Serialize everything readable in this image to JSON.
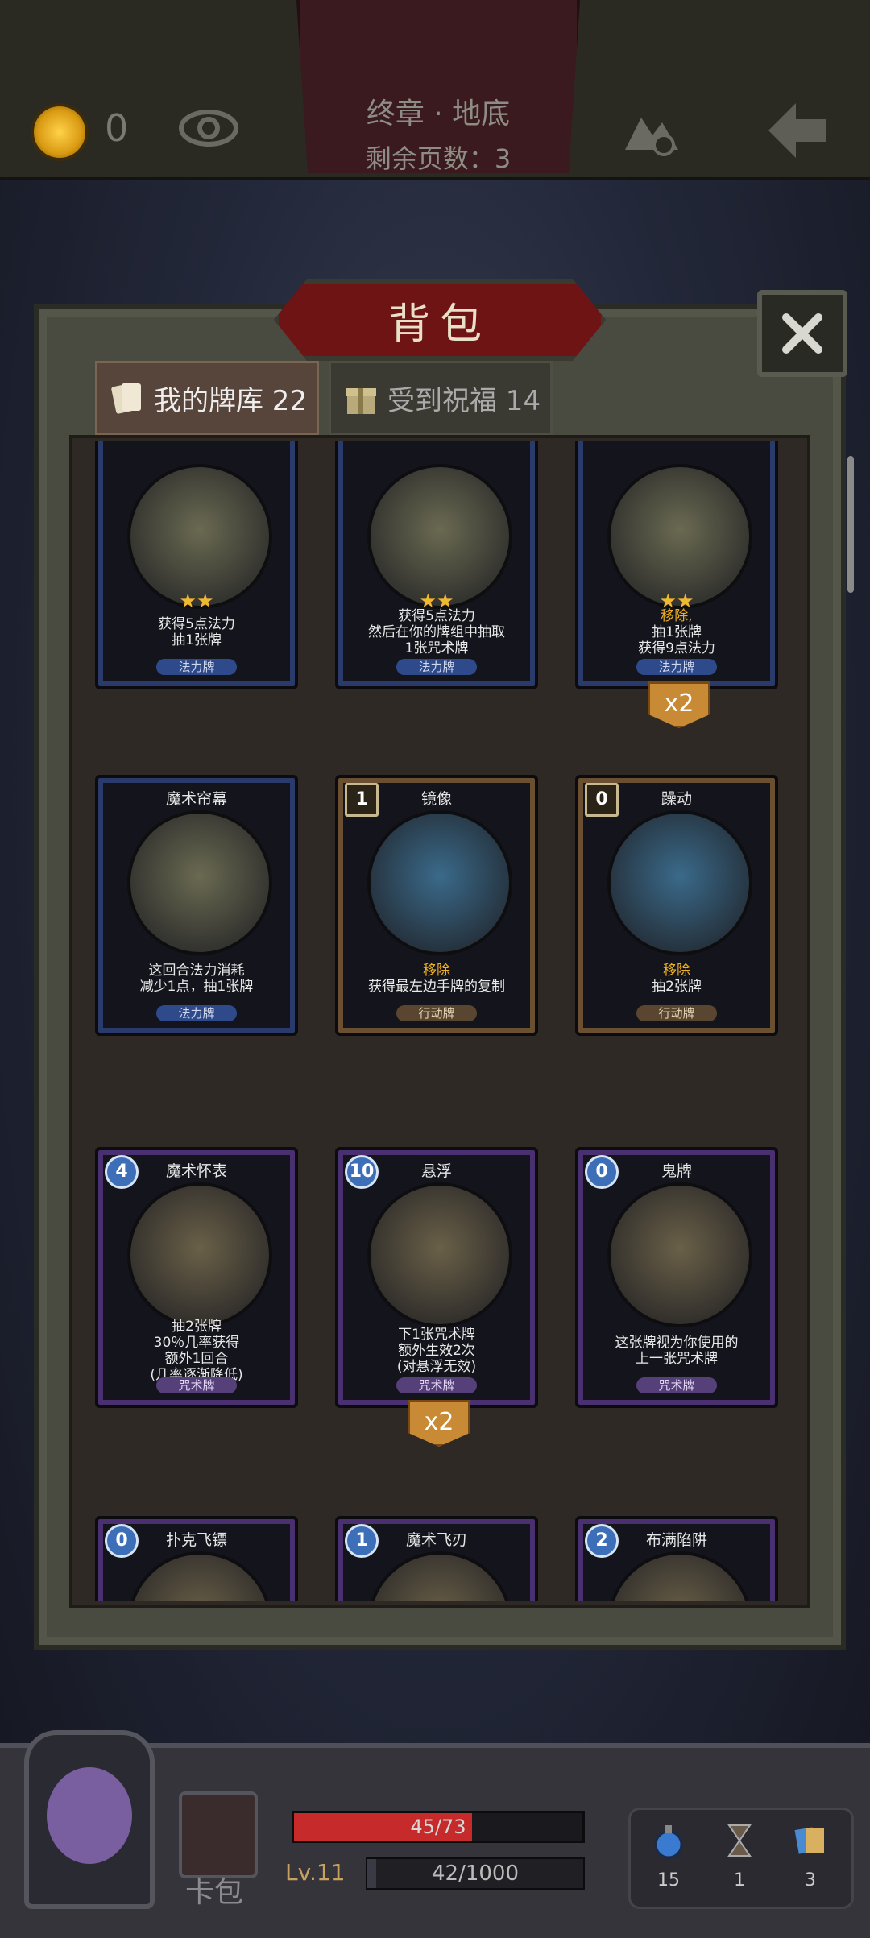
{
  "top": {
    "coins": "0",
    "chapter_title": "终章 · 地底",
    "pages_left": "剩余页数：3"
  },
  "panel": {
    "title": "背包",
    "tabs": [
      {
        "label": "我的牌库 22",
        "active": true
      },
      {
        "label": "受到祝福 14",
        "active": false
      }
    ]
  },
  "cards": [
    {
      "name": "",
      "cost": "",
      "color": "blue",
      "stars": "★★",
      "desc": [
        "获得5点法力",
        "抽1张牌"
      ],
      "highlight": "",
      "type": "法力牌",
      "qty": ""
    },
    {
      "name": "",
      "cost": "",
      "color": "blue",
      "stars": "★★",
      "desc": [
        "获得5点法力",
        "然后在你的牌组中抽取",
        "1张咒术牌"
      ],
      "highlight": "",
      "type": "法力牌",
      "qty": ""
    },
    {
      "name": "",
      "cost": "",
      "color": "blue",
      "stars": "★★",
      "desc": [
        "抽1张牌",
        "获得9点法力"
      ],
      "highlight": "移除,",
      "type": "法力牌",
      "qty": "x2"
    },
    {
      "name": "魔术帘幕",
      "cost": "",
      "color": "blue",
      "stars": "",
      "desc": [
        "这回合法力消耗",
        "减少1点，抽1张牌"
      ],
      "highlight": "",
      "type": "法力牌",
      "qty": ""
    },
    {
      "name": "镜像",
      "cost": "1",
      "color": "brown",
      "stars": "",
      "desc": [
        "获得最左边手牌的复制"
      ],
      "highlight": "移除",
      "type": "行动牌",
      "qty": ""
    },
    {
      "name": "躁动",
      "cost": "0",
      "color": "brown",
      "stars": "",
      "desc": [
        "抽2张牌"
      ],
      "highlight": "移除",
      "type": "行动牌",
      "qty": ""
    },
    {
      "name": "魔术怀表",
      "cost": "4",
      "color": "purple",
      "stars": "",
      "desc": [
        "抽2张牌",
        "30％几率获得",
        "额外1回合",
        "(几率逐渐降低)"
      ],
      "highlight": "",
      "type": "咒术牌",
      "qty": ""
    },
    {
      "name": "悬浮",
      "cost": "10",
      "color": "purple",
      "stars": "",
      "desc": [
        "下1张咒术牌",
        "额外生效2次",
        "(对悬浮无效)"
      ],
      "highlight": "",
      "type": "咒术牌",
      "qty": "x2"
    },
    {
      "name": "鬼牌",
      "cost": "0",
      "color": "purple",
      "stars": "",
      "desc": [
        "这张牌视为你使用的",
        "上一张咒术牌"
      ],
      "highlight": "",
      "type": "咒术牌",
      "qty": ""
    },
    {
      "name": "扑克飞镖",
      "cost": "0",
      "color": "purple",
      "stars": "",
      "desc": [],
      "highlight": "",
      "type": "",
      "qty": ""
    },
    {
      "name": "魔术飞刃",
      "cost": "1",
      "color": "purple",
      "stars": "",
      "desc": [],
      "highlight": "",
      "type": "",
      "qty": ""
    },
    {
      "name": "布满陷阱",
      "cost": "2",
      "color": "purple",
      "stars": "",
      "desc": [],
      "highlight": "",
      "type": "",
      "qty": ""
    }
  ],
  "bottom": {
    "card_pack_label": "卡包",
    "hp_text": "45/73",
    "hp_fraction": 0.616,
    "level": "Lv.11",
    "xp_text": "42/1000",
    "xp_fraction": 0.042,
    "resources": [
      {
        "icon": "potion-icon",
        "value": "15"
      },
      {
        "icon": "hourglass-icon",
        "value": "1"
      },
      {
        "icon": "cards-icon",
        "value": "3"
      }
    ]
  }
}
